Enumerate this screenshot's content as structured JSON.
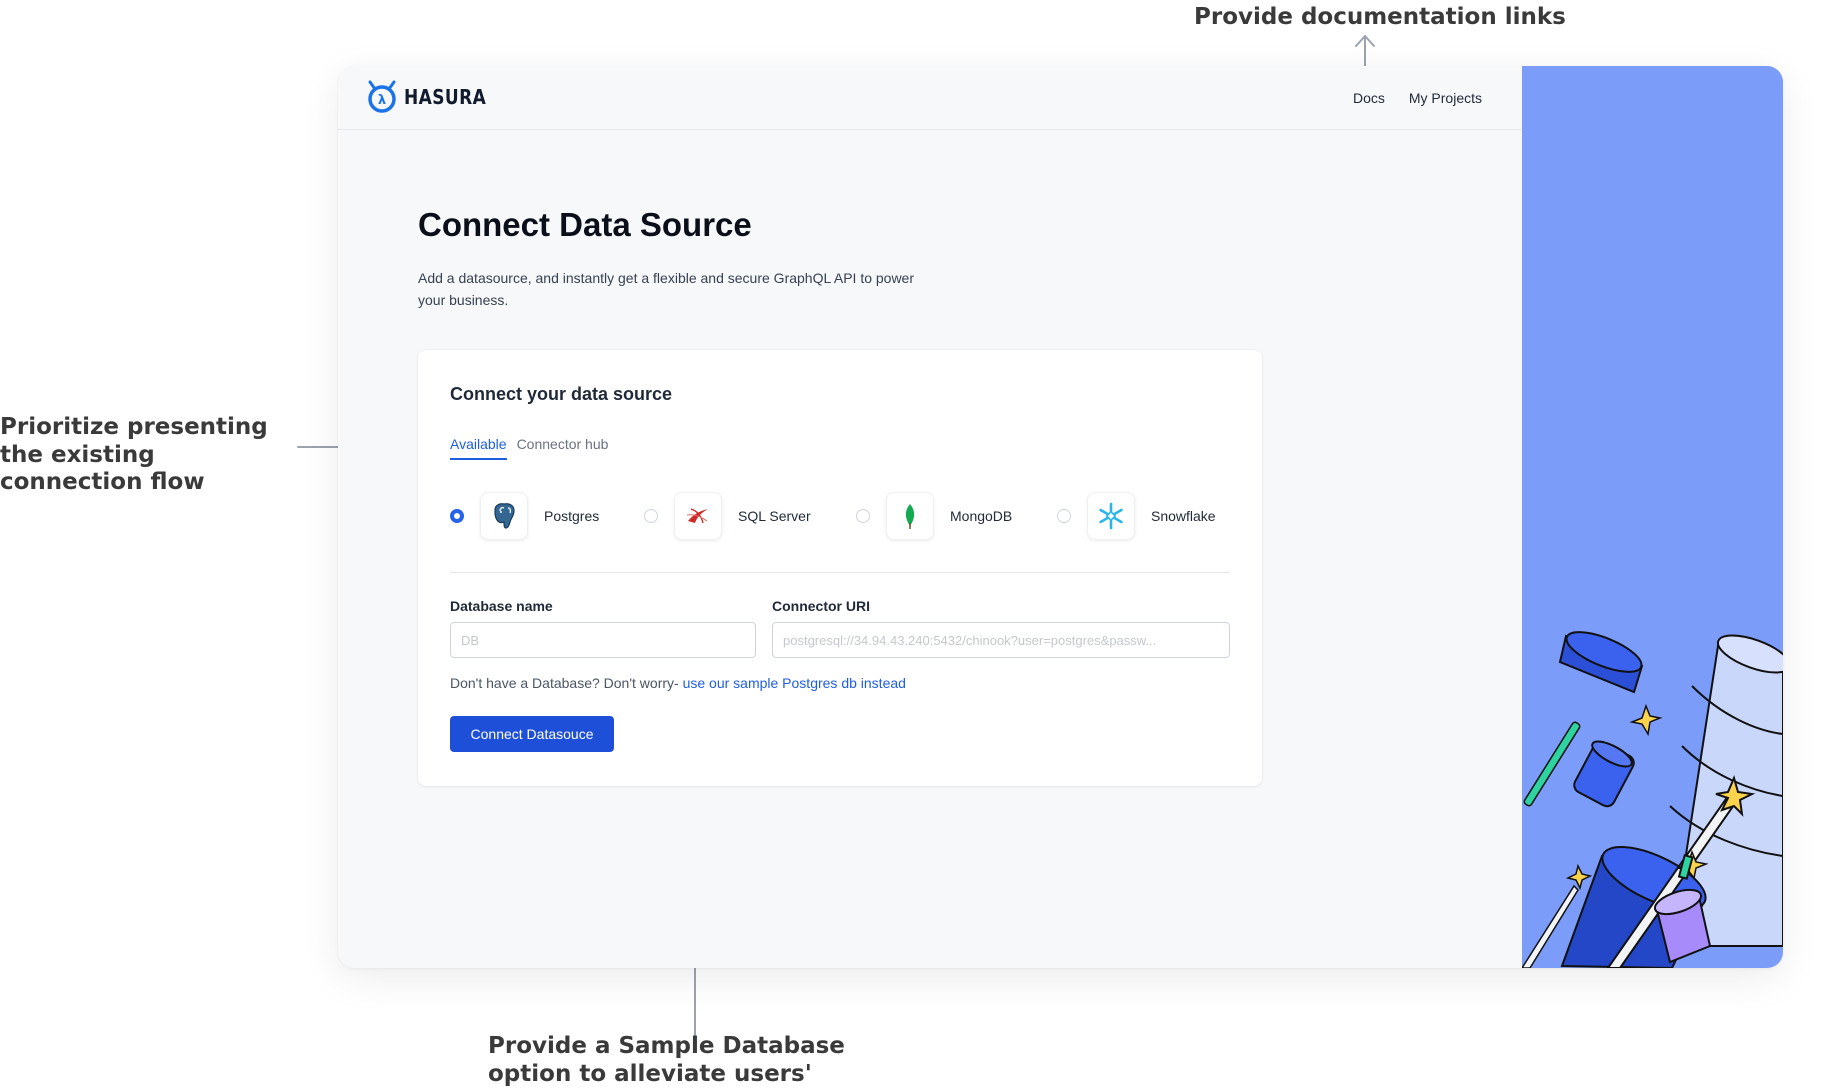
{
  "annotations": {
    "docs": "Provide documentation links",
    "existing_flow": "Prioritize presenting the existing connection flow",
    "sample_db": "Provide a Sample Database option to alleviate users' prerequisites"
  },
  "header": {
    "logo_text": "HASURA",
    "nav": {
      "docs": "Docs",
      "projects": "My Projects"
    }
  },
  "page": {
    "title": "Connect Data Source",
    "description": "Add a datasource, and instantly get a flexible and secure GraphQL API to power your business."
  },
  "card": {
    "title": "Connect your data source",
    "tabs": {
      "available": "Available",
      "hub": "Connector hub"
    },
    "sources": {
      "postgres": {
        "label": "Postgres",
        "icon": "postgres-elephant-icon",
        "selected": true
      },
      "sqlserver": {
        "label": "SQL Server",
        "icon": "sql-server-icon",
        "selected": false
      },
      "mongodb": {
        "label": "MongoDB",
        "icon": "mongodb-leaf-icon",
        "selected": false
      },
      "snowflake": {
        "label": "Snowflake",
        "icon": "snowflake-icon",
        "selected": false
      }
    },
    "fields": {
      "db_name": {
        "label": "Database name",
        "placeholder": "DB"
      },
      "uri": {
        "label": "Connector URI",
        "placeholder": "postgresql://34.94.43.240:5432/chinook?user=postgres&passw..."
      }
    },
    "hint": {
      "text": "Don't have a Database? Don't worry-",
      "link": "use our sample Postgres db instead"
    },
    "button": "Connect Datasouce"
  },
  "colors": {
    "accent": "#1d4fd8",
    "link": "#1f5ee0",
    "illustration_bg": "#7b9cf8",
    "annotation_text": "#3a3a3a"
  }
}
